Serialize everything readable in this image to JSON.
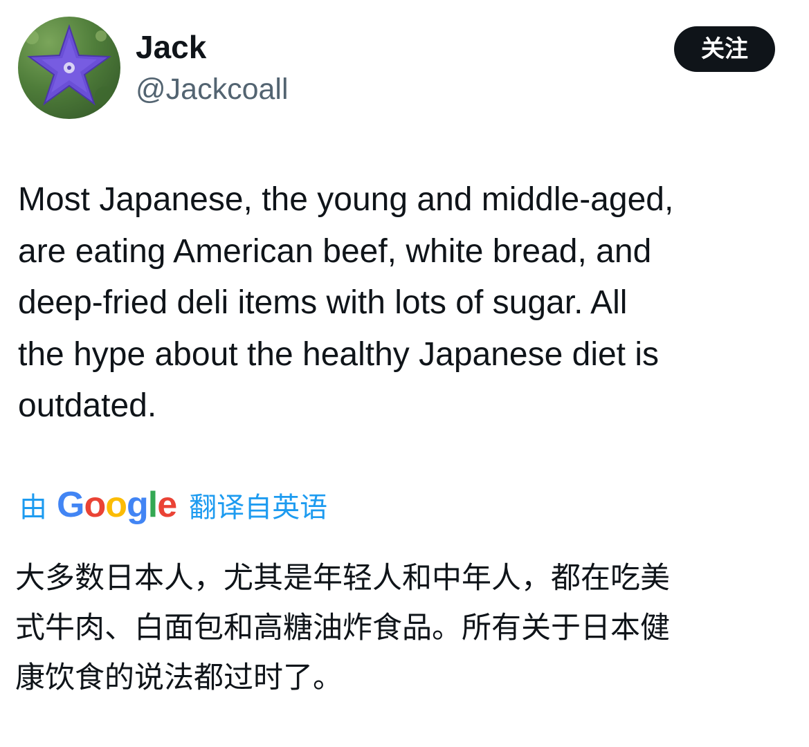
{
  "author": {
    "name": "Jack",
    "handle": "@Jackcoall",
    "avatar_icon": "purple-star-flower-avatar"
  },
  "follow_button": {
    "label": "关注"
  },
  "tweet": {
    "text": "Most Japanese, the young and middle-aged,\nare eating American beef, white bread, and\ndeep-fried deli items with lots of sugar. All\nthe hype about the healthy Japanese diet is\noutdated."
  },
  "translation": {
    "prefix": "由",
    "provider_letters": [
      "G",
      "o",
      "o",
      "g",
      "l",
      "e"
    ],
    "label": "翻译自英语",
    "text": "大多数日本人，尤其是年轻人和中年人，都在吃美\n式牛肉、白面包和高糖油炸食品。所有关于日本健\n康饮食的说法都过时了。"
  },
  "colors": {
    "link_blue": "#1d9bf0",
    "text": "#0f1419",
    "secondary": "#536471",
    "google_blue": "#4285f4",
    "google_red": "#ea4335",
    "google_yellow": "#fbbc05",
    "google_green": "#34a853"
  }
}
